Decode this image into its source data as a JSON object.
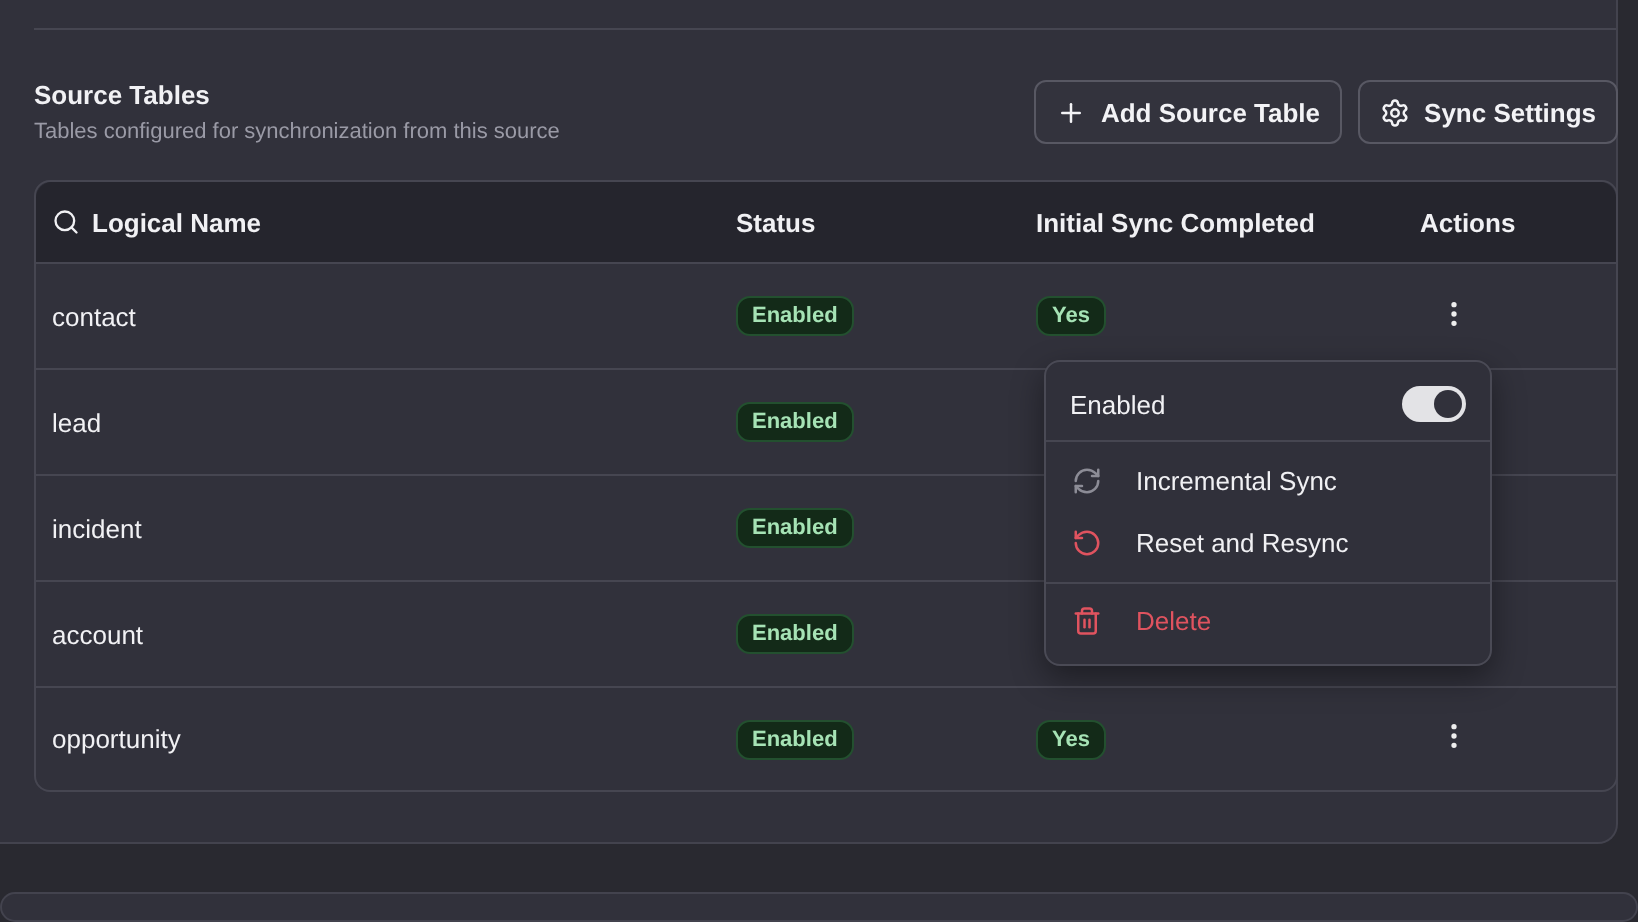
{
  "section": {
    "title": "Source Tables",
    "subtitle": "Tables configured for synchronization from this source"
  },
  "buttons": [
    {
      "kind": "add",
      "label": "Add Source Table"
    },
    {
      "kind": "settings",
      "label": "Sync Settings"
    }
  ],
  "table": {
    "columns": [
      "Logical Name",
      "Status",
      "Initial Sync Completed",
      "Actions"
    ],
    "rows": [
      {
        "name": "contact",
        "status": "Enabled",
        "initial_sync": "Yes",
        "action_menu": {
          "toggle": {
            "label": "Enabled",
            "on": true
          },
          "items": [
            {
              "kind": "sync",
              "label": "Incremental Sync",
              "danger": false
            },
            {
              "kind": "reset",
              "label": "Reset and Resync",
              "danger": false
            },
            {
              "kind": "delete",
              "label": "Delete",
              "danger": true
            }
          ]
        }
      },
      {
        "name": "lead",
        "status": "Enabled"
      },
      {
        "name": "incident",
        "status": "Enabled"
      },
      {
        "name": "account",
        "status": "Enabled"
      },
      {
        "name": "opportunity",
        "status": "Enabled",
        "initial_sync": "Yes"
      }
    ]
  }
}
